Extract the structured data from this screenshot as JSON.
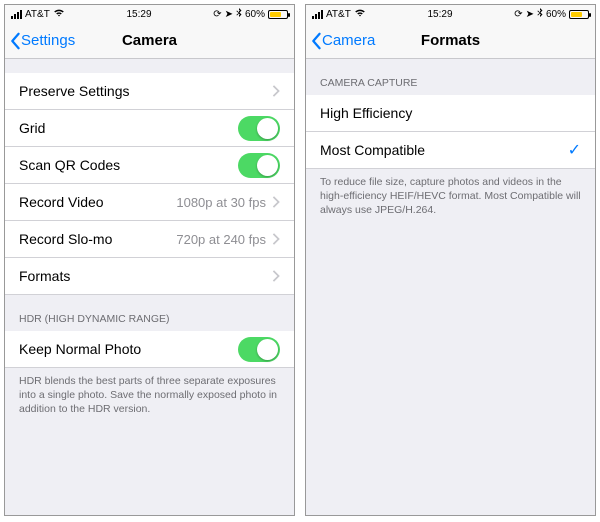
{
  "status": {
    "carrier": "AT&T",
    "time": "15:29",
    "battery_pct": "60%"
  },
  "left": {
    "back_label": "Settings",
    "title": "Camera",
    "rows": {
      "preserve": "Preserve Settings",
      "grid": "Grid",
      "scan_qr": "Scan QR Codes",
      "record_video": "Record Video",
      "record_video_detail": "1080p at 30 fps",
      "record_slomo": "Record Slo-mo",
      "record_slomo_detail": "720p at 240 fps",
      "formats": "Formats"
    },
    "hdr_header": "HDR (HIGH DYNAMIC RANGE)",
    "keep_normal": "Keep Normal Photo",
    "hdr_footer": "HDR blends the best parts of three separate exposures into a single photo. Save the normally exposed photo in addition to the HDR version."
  },
  "right": {
    "back_label": "Camera",
    "title": "Formats",
    "section_header": "CAMERA CAPTURE",
    "high_eff": "High Efficiency",
    "most_compat": "Most Compatible",
    "footer": "To reduce file size, capture photos and videos in the high-efficiency HEIF/HEVC format. Most Compatible will always use JPEG/H.264."
  }
}
